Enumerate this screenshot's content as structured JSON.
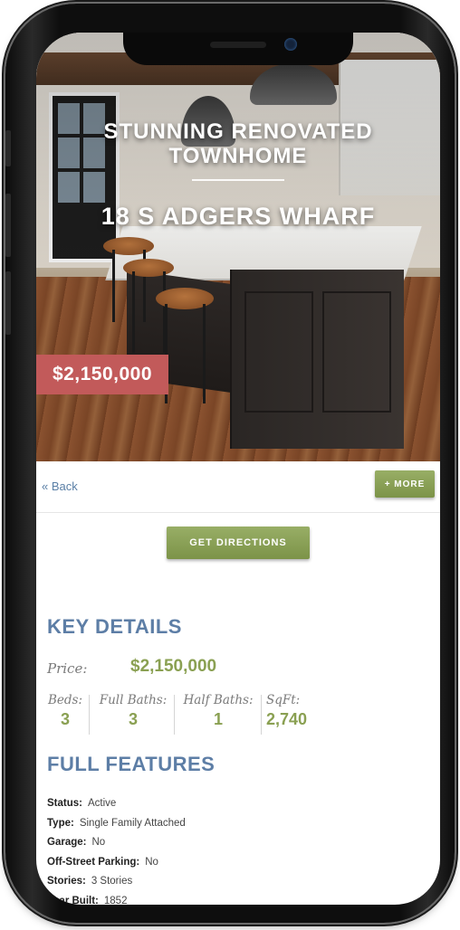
{
  "listing": {
    "headline": "STUNNING RENOVATED TOWNHOME",
    "address": "18 S ADGERS WHARF",
    "price_tag": "$2,150,000"
  },
  "nav": {
    "back_label": "« Back",
    "more_label": "+ MORE"
  },
  "actions": {
    "directions_label": "GET DIRECTIONS"
  },
  "key_details": {
    "title": "KEY DETAILS",
    "price_label": "Price:",
    "price_value": "$2,150,000",
    "stats": [
      {
        "label": "Beds:",
        "value": "3"
      },
      {
        "label": "Full Baths:",
        "value": "3"
      },
      {
        "label": "Half Baths:",
        "value": "1"
      },
      {
        "label": "SqFt:",
        "value": "2,740"
      }
    ]
  },
  "full_features": {
    "title": "FULL FEATURES",
    "items": [
      {
        "key": "Status:",
        "value": "Active"
      },
      {
        "key": "Type:",
        "value": "Single Family Attached"
      },
      {
        "key": "Garage:",
        "value": "No"
      },
      {
        "key": "Off-Street Parking:",
        "value": "No"
      },
      {
        "key": "Stories:",
        "value": "3 Stories"
      },
      {
        "key": "Year Built:",
        "value": "1852"
      }
    ]
  },
  "colors": {
    "accent_blue": "#5d7ea6",
    "accent_green": "#8aa052",
    "price_tag_red": "#c25a5a"
  }
}
